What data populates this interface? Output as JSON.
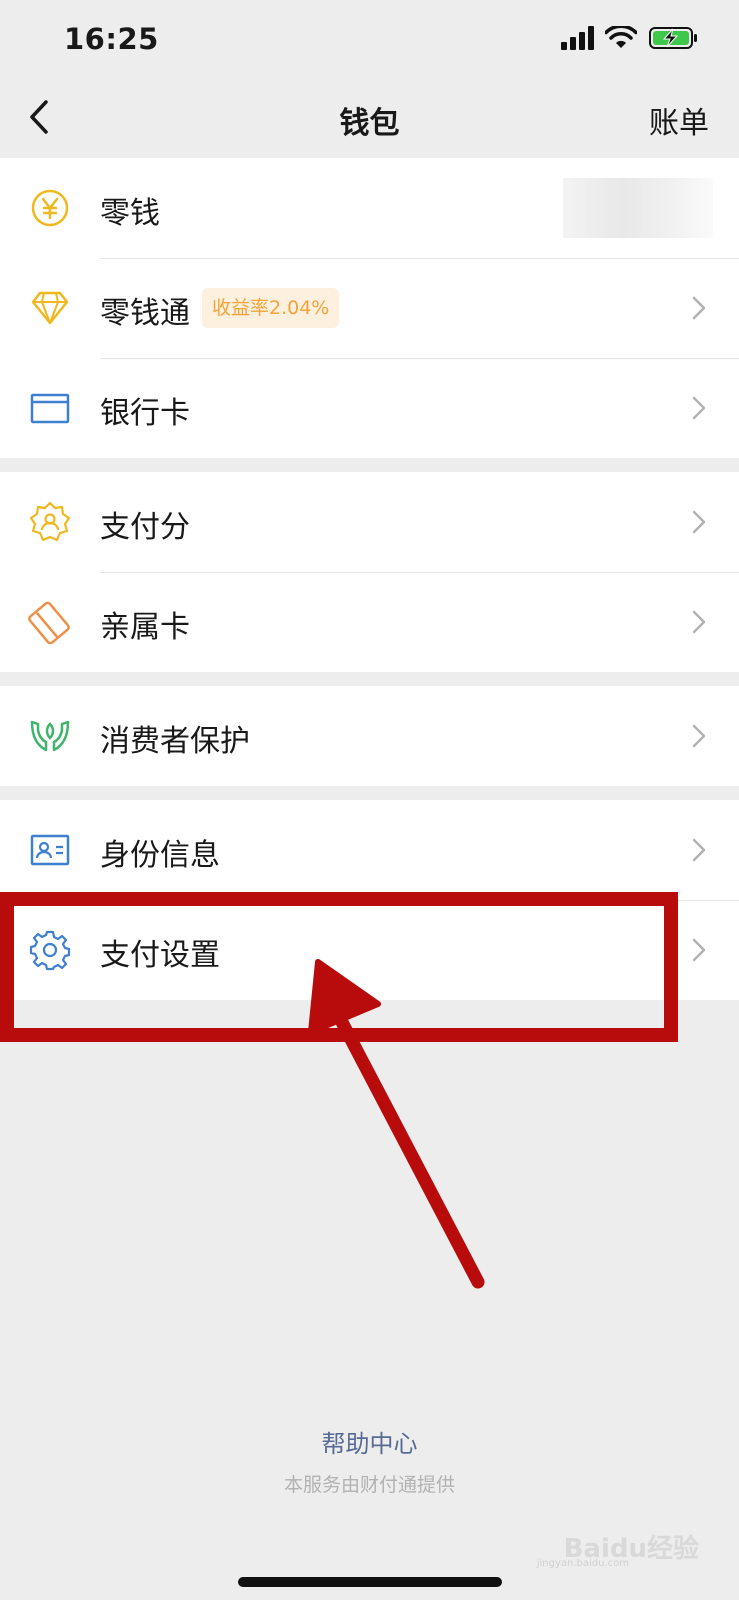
{
  "status": {
    "time": "16:25"
  },
  "nav": {
    "title": "钱包",
    "right_label": "账单"
  },
  "groups": [
    {
      "items": [
        {
          "label": "零钱",
          "icon": "yuan-coin-icon"
        },
        {
          "label": "零钱通",
          "icon": "diamond-icon",
          "badge": "收益率2.04%"
        },
        {
          "label": "银行卡",
          "icon": "bank-card-icon"
        }
      ]
    },
    {
      "items": [
        {
          "label": "支付分",
          "icon": "score-badge-icon"
        },
        {
          "label": "亲属卡",
          "icon": "family-card-icon"
        }
      ]
    },
    {
      "items": [
        {
          "label": "消费者保护",
          "icon": "protect-hands-icon"
        }
      ]
    },
    {
      "items": [
        {
          "label": "身份信息",
          "icon": "id-card-icon"
        },
        {
          "label": "支付设置",
          "icon": "gear-icon"
        }
      ]
    }
  ],
  "footer": {
    "help": "帮助中心",
    "provider": "本服务由财付通提供"
  },
  "watermark": {
    "text": "Baidu经验",
    "sub": "jingyan.baidu.com"
  },
  "colors": {
    "accent_link": "#576b95",
    "highlight": "#b80c0c",
    "badge_text": "#f2a33a",
    "badge_bg": "#fdf0df"
  }
}
